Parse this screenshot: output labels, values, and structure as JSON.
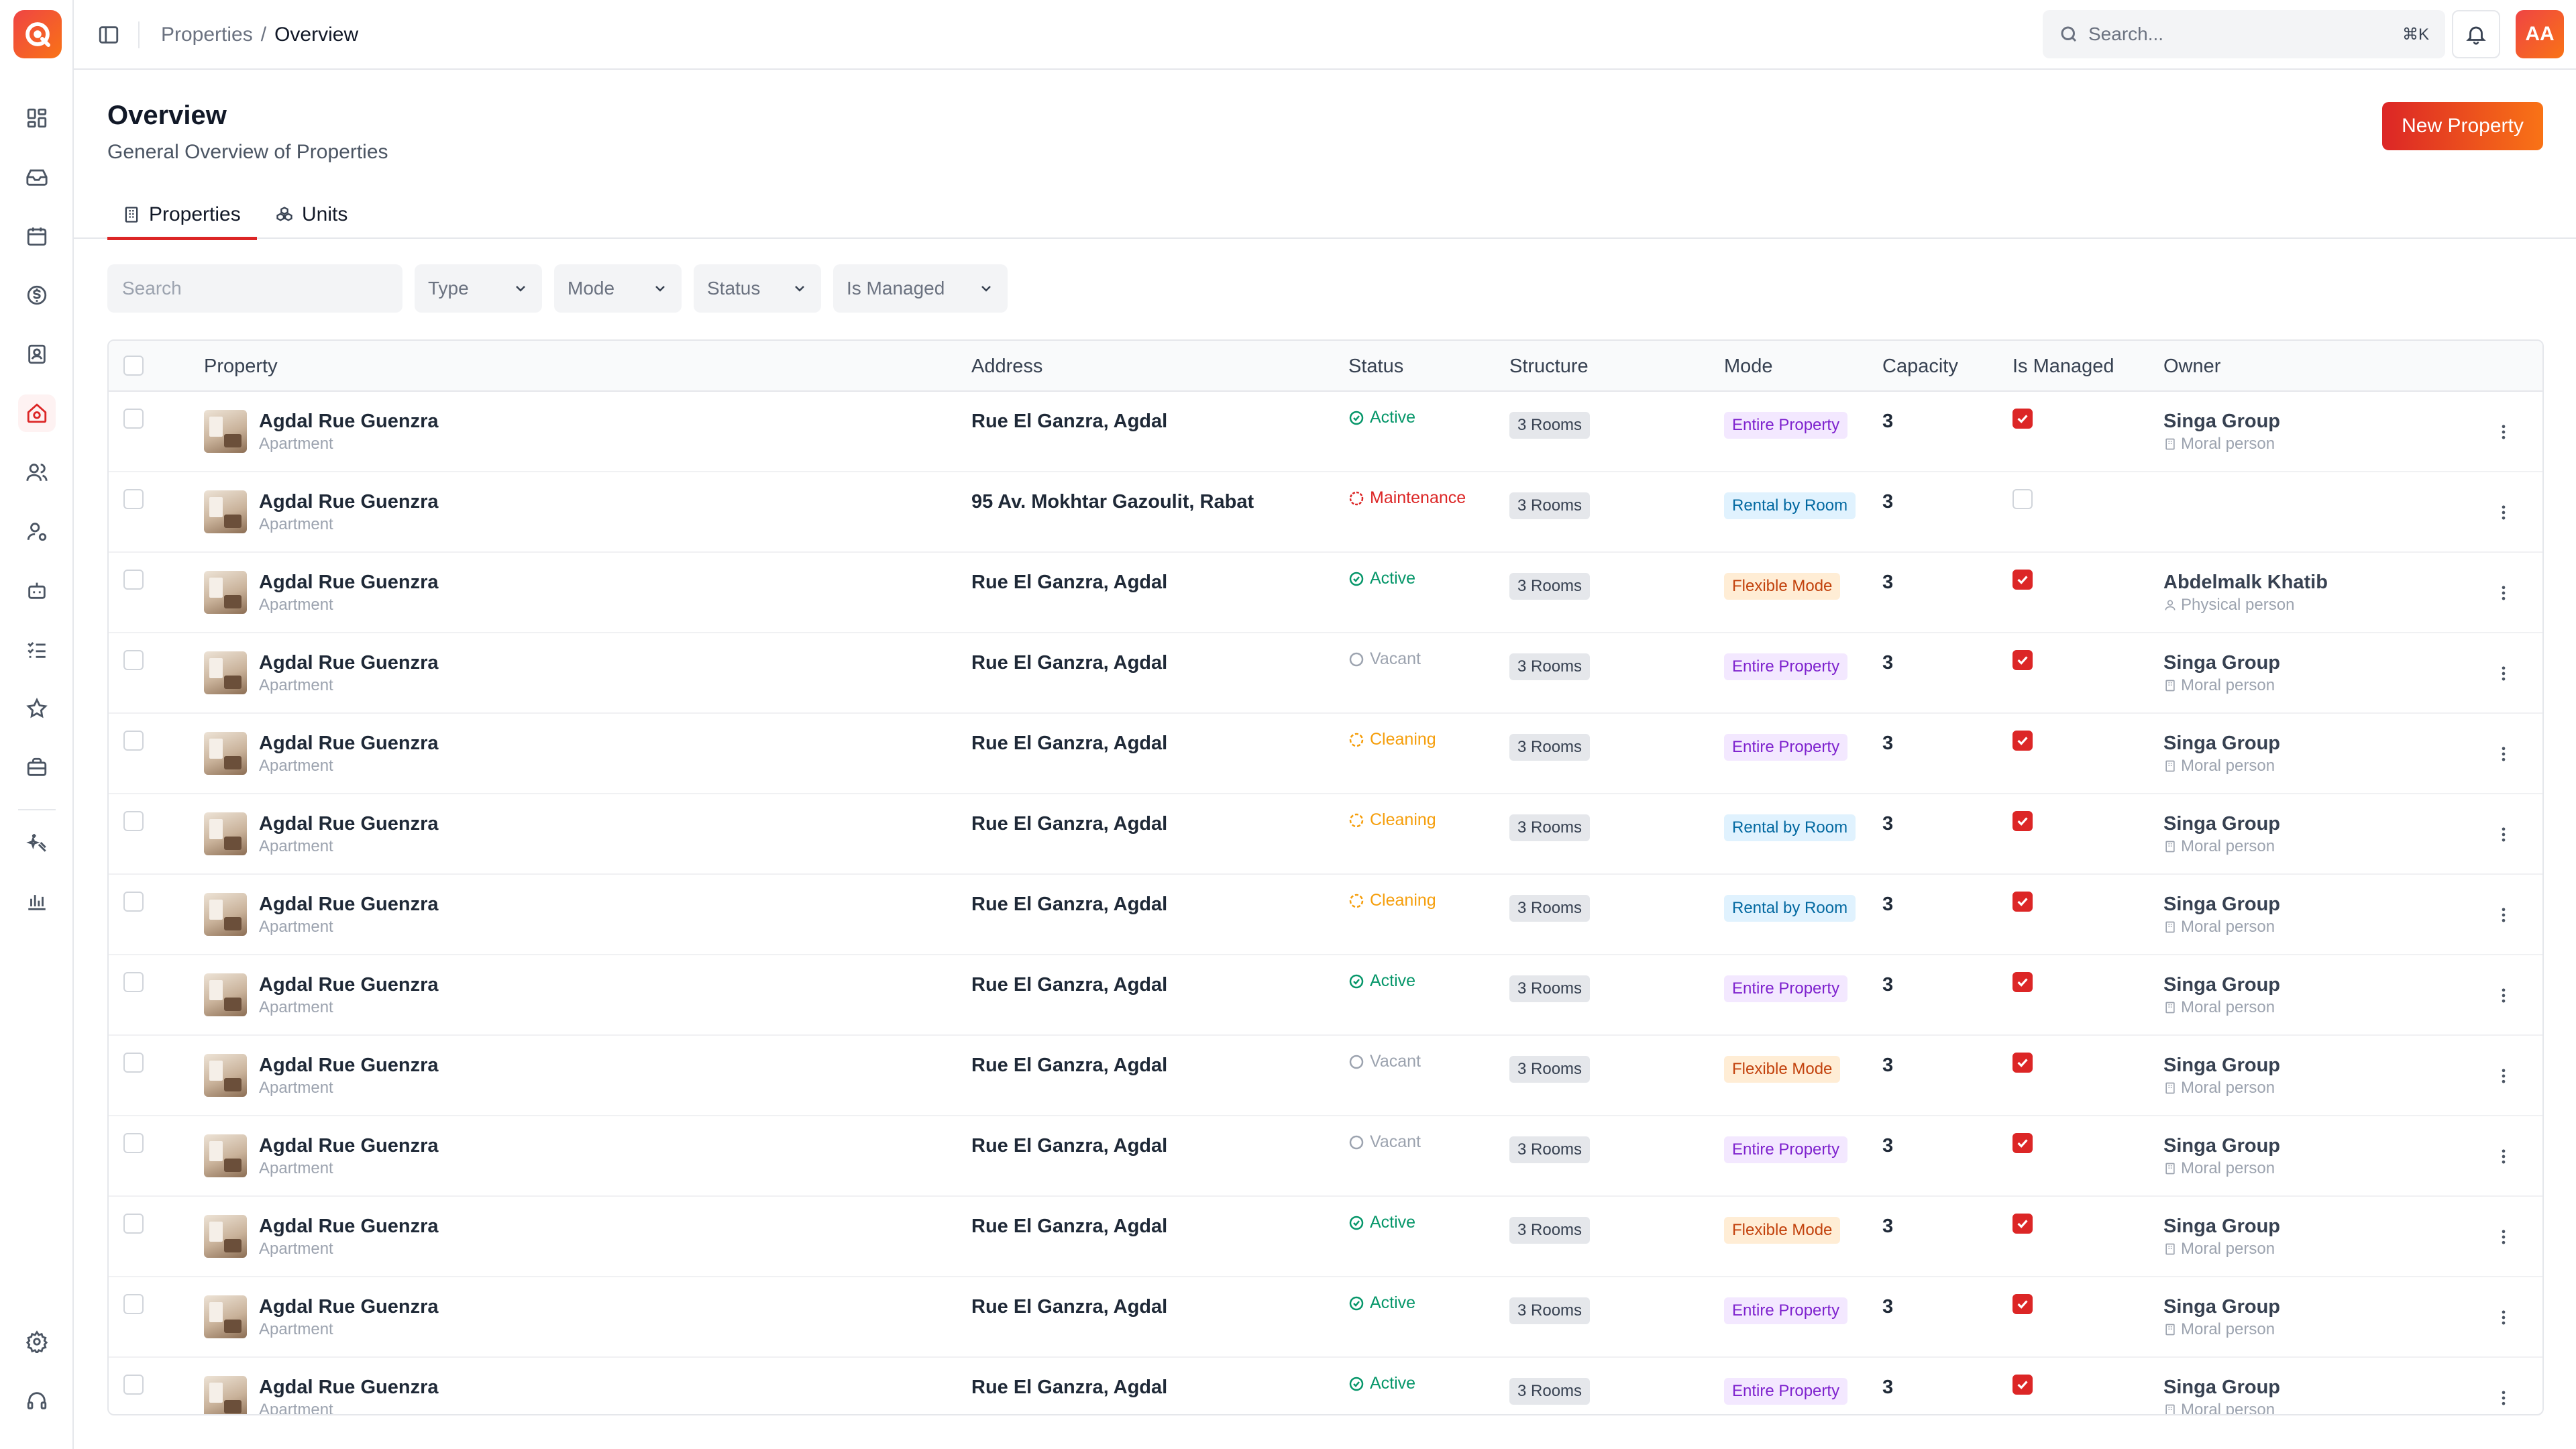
{
  "app": {
    "logo_icon": "app-logo-icon",
    "brand_gradient": [
      "#dc2626",
      "#f97316"
    ]
  },
  "sidebar": {
    "items": [
      {
        "name": "dashboard",
        "icon": "dashboard-icon"
      },
      {
        "name": "inbox",
        "icon": "inbox-icon"
      },
      {
        "name": "calendar",
        "icon": "calendar-icon"
      },
      {
        "name": "finance",
        "icon": "dollar-icon"
      },
      {
        "name": "contacts",
        "icon": "contact-book-icon"
      },
      {
        "name": "properties",
        "icon": "home-icon",
        "active": true
      },
      {
        "name": "users",
        "icon": "users-icon"
      },
      {
        "name": "user-settings",
        "icon": "user-gear-icon"
      },
      {
        "name": "bot",
        "icon": "bot-icon"
      },
      {
        "name": "tasks",
        "icon": "checklist-icon"
      },
      {
        "name": "reviews",
        "icon": "star-icon"
      },
      {
        "name": "briefcase",
        "icon": "briefcase-icon"
      },
      {
        "name": "cleaning",
        "icon": "sparkle-icon"
      },
      {
        "name": "analytics",
        "icon": "bar-chart-icon"
      }
    ],
    "bottom": [
      {
        "name": "settings",
        "icon": "gear-icon"
      },
      {
        "name": "support",
        "icon": "headset-icon"
      }
    ]
  },
  "header": {
    "breadcrumb": {
      "parent": "Properties",
      "separator": "/",
      "current": "Overview"
    },
    "search": {
      "placeholder": "Search...",
      "shortcut": "⌘K"
    },
    "avatar": "AA"
  },
  "page": {
    "title": "Overview",
    "subtitle": "General Overview of Properties",
    "new_button": "New Property"
  },
  "tabs": [
    {
      "label": "Properties",
      "icon": "building-icon",
      "active": true
    },
    {
      "label": "Units",
      "icon": "cubes-icon",
      "active": false
    }
  ],
  "filters": {
    "search_placeholder": "Search",
    "type": "Type",
    "mode": "Mode",
    "status": "Status",
    "managed": "Is Managed"
  },
  "table": {
    "columns": {
      "property": "Property",
      "address": "Address",
      "status": "Status",
      "structure": "Structure",
      "mode": "Mode",
      "capacity": "Capacity",
      "managed": "Is Managed",
      "owner": "Owner"
    },
    "status_colors": {
      "Active": "#059669",
      "Maintenance": "#dc2626",
      "Vacant": "#9ca3af",
      "Cleaning": "#f59e0b"
    },
    "mode_colors": {
      "Entire Property": {
        "bg": "#f3e8ff",
        "fg": "#7e22ce"
      },
      "Rental by Room": {
        "bg": "#e0f2fe",
        "fg": "#0369a1"
      },
      "Flexible Mode": {
        "bg": "#ffedd5",
        "fg": "#c2410c"
      }
    },
    "rows": [
      {
        "name": "Agdal Rue Guenzra",
        "type": "Apartment",
        "address": "Rue El Ganzra, Agdal",
        "status": "Active",
        "structure": "3 Rooms",
        "mode": "Entire Property",
        "capacity": "3",
        "managed": true,
        "owner": "Singa Group",
        "owner_type": "Moral person"
      },
      {
        "name": "Agdal Rue Guenzra",
        "type": "Apartment",
        "address": "95 Av. Mokhtar Gazoulit, Rabat",
        "status": "Maintenance",
        "structure": "3 Rooms",
        "mode": "Rental by Room",
        "capacity": "3",
        "managed": false,
        "owner": "",
        "owner_type": ""
      },
      {
        "name": "Agdal Rue Guenzra",
        "type": "Apartment",
        "address": "Rue El Ganzra, Agdal",
        "status": "Active",
        "structure": "3 Rooms",
        "mode": "Flexible Mode",
        "capacity": "3",
        "managed": true,
        "owner": "Abdelmalk Khatib",
        "owner_type": "Physical person"
      },
      {
        "name": "Agdal Rue Guenzra",
        "type": "Apartment",
        "address": "Rue El Ganzra, Agdal",
        "status": "Vacant",
        "structure": "3 Rooms",
        "mode": "Entire Property",
        "capacity": "3",
        "managed": true,
        "owner": "Singa Group",
        "owner_type": "Moral person"
      },
      {
        "name": "Agdal Rue Guenzra",
        "type": "Apartment",
        "address": "Rue El Ganzra, Agdal",
        "status": "Cleaning",
        "structure": "3 Rooms",
        "mode": "Entire Property",
        "capacity": "3",
        "managed": true,
        "owner": "Singa Group",
        "owner_type": "Moral person"
      },
      {
        "name": "Agdal Rue Guenzra",
        "type": "Apartment",
        "address": "Rue El Ganzra, Agdal",
        "status": "Cleaning",
        "structure": "3 Rooms",
        "mode": "Rental by Room",
        "capacity": "3",
        "managed": true,
        "owner": "Singa Group",
        "owner_type": "Moral person"
      },
      {
        "name": "Agdal Rue Guenzra",
        "type": "Apartment",
        "address": "Rue El Ganzra, Agdal",
        "status": "Cleaning",
        "structure": "3 Rooms",
        "mode": "Rental by Room",
        "capacity": "3",
        "managed": true,
        "owner": "Singa Group",
        "owner_type": "Moral person"
      },
      {
        "name": "Agdal Rue Guenzra",
        "type": "Apartment",
        "address": "Rue El Ganzra, Agdal",
        "status": "Active",
        "structure": "3 Rooms",
        "mode": "Entire Property",
        "capacity": "3",
        "managed": true,
        "owner": "Singa Group",
        "owner_type": "Moral person"
      },
      {
        "name": "Agdal Rue Guenzra",
        "type": "Apartment",
        "address": "Rue El Ganzra, Agdal",
        "status": "Vacant",
        "structure": "3 Rooms",
        "mode": "Flexible Mode",
        "capacity": "3",
        "managed": true,
        "owner": "Singa Group",
        "owner_type": "Moral person"
      },
      {
        "name": "Agdal Rue Guenzra",
        "type": "Apartment",
        "address": "Rue El Ganzra, Agdal",
        "status": "Vacant",
        "structure": "3 Rooms",
        "mode": "Entire Property",
        "capacity": "3",
        "managed": true,
        "owner": "Singa Group",
        "owner_type": "Moral person"
      },
      {
        "name": "Agdal Rue Guenzra",
        "type": "Apartment",
        "address": "Rue El Ganzra, Agdal",
        "status": "Active",
        "structure": "3 Rooms",
        "mode": "Flexible Mode",
        "capacity": "3",
        "managed": true,
        "owner": "Singa Group",
        "owner_type": "Moral person"
      },
      {
        "name": "Agdal Rue Guenzra",
        "type": "Apartment",
        "address": "Rue El Ganzra, Agdal",
        "status": "Active",
        "structure": "3 Rooms",
        "mode": "Entire Property",
        "capacity": "3",
        "managed": true,
        "owner": "Singa Group",
        "owner_type": "Moral person"
      },
      {
        "name": "Agdal Rue Guenzra",
        "type": "Apartment",
        "address": "Rue El Ganzra, Agdal",
        "status": "Active",
        "structure": "3 Rooms",
        "mode": "Entire Property",
        "capacity": "3",
        "managed": true,
        "owner": "Singa Group",
        "owner_type": "Moral person"
      }
    ]
  }
}
